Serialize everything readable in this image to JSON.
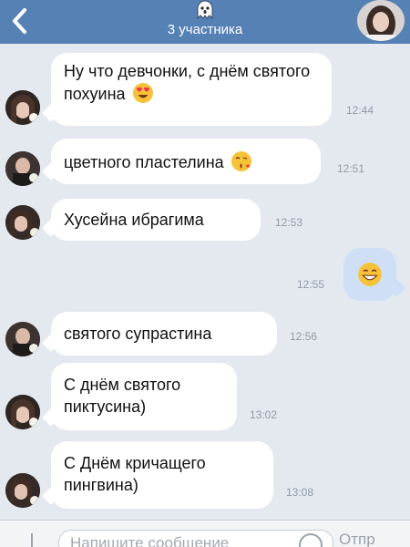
{
  "header": {
    "subtitle": "3 участника",
    "icons": [
      "back-chevron-icon",
      "ghost-icon",
      "avatar"
    ]
  },
  "messages": [
    {
      "text": "Ну что девчонки, с днём святого похуина",
      "emoji": "heart-eyes",
      "time": "12:44",
      "direction": "in"
    },
    {
      "text": "цветного пластелина",
      "emoji": "kissing-face",
      "time": "12:51",
      "direction": "in"
    },
    {
      "text": "Хусейна ибрагима",
      "time": "12:53",
      "direction": "in"
    },
    {
      "text": "",
      "emoji": "grinning-face",
      "time": "12:55",
      "direction": "out"
    },
    {
      "text": "святого супрастина",
      "time": "12:56",
      "direction": "in"
    },
    {
      "text": "С днём святого пиктусина)",
      "time": "13:02",
      "direction": "in"
    },
    {
      "text": "С Днём кричащего пингвина)",
      "time": "13:08",
      "direction": "in"
    }
  ],
  "input": {
    "placeholder": "Напишите сообщение",
    "send_label": "Отпр"
  },
  "colors": {
    "header": "#5681b5",
    "background": "#e4e9f0",
    "incoming_bubble": "#ffffff",
    "outgoing_bubble": "#cfe0f6",
    "time_text": "#8f9aa8"
  }
}
